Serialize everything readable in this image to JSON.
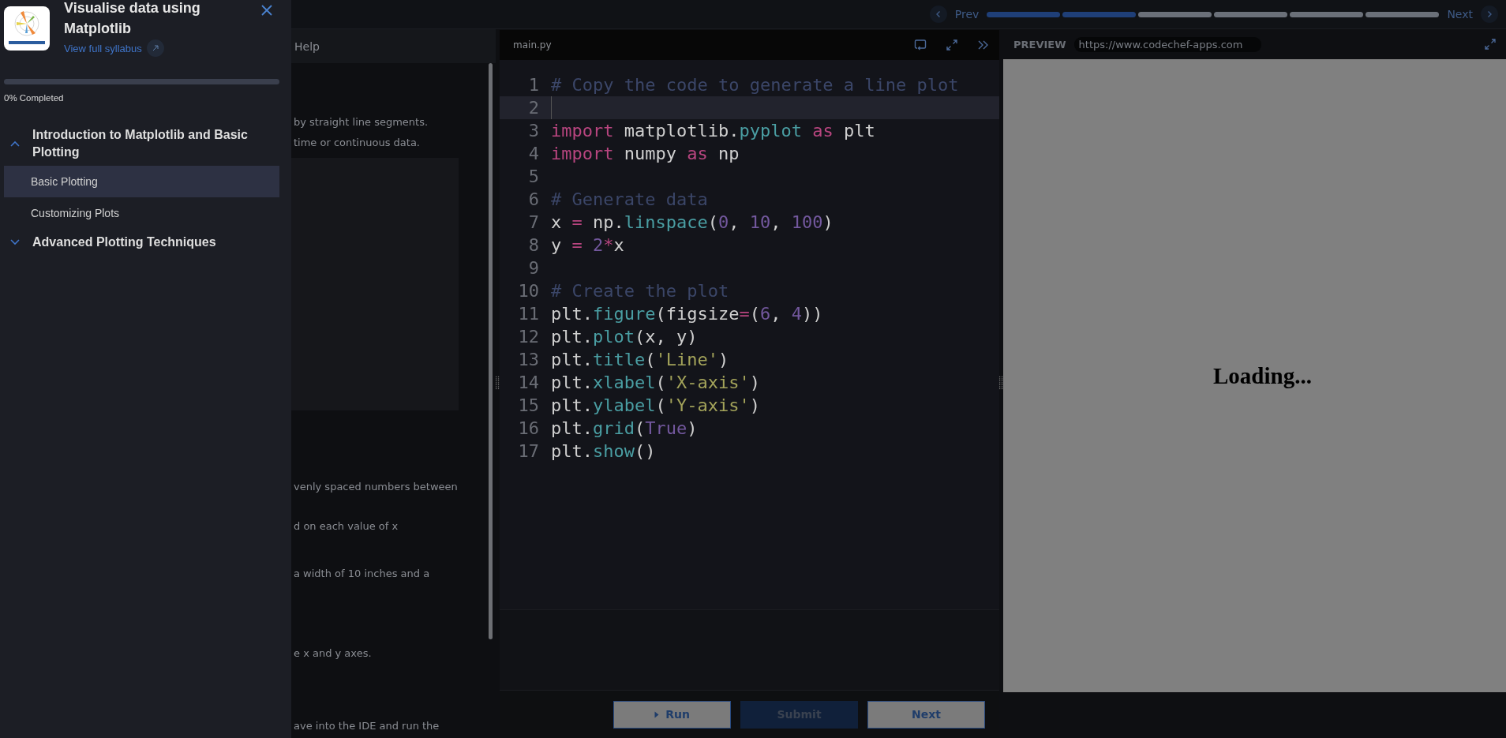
{
  "sidebar": {
    "title": "Visualise data using Matplotlib",
    "syllabus_link": "View full syllabus",
    "progress": {
      "level": 0,
      "label": "0% Completed"
    },
    "sections": [
      {
        "title": "Introduction to Matplotlib and Basic Plotting",
        "expanded": true,
        "children": [
          {
            "label": "Basic Plotting",
            "selected": true
          },
          {
            "label": "Customizing Plots",
            "selected": false
          }
        ]
      },
      {
        "title": "Advanced Plotting Techniques",
        "expanded": false
      }
    ]
  },
  "top_nav": {
    "prev": "Prev",
    "next": "Next",
    "steps": [
      {
        "completed": true
      },
      {
        "completed": true
      },
      {
        "completed": false
      },
      {
        "completed": false
      },
      {
        "completed": false
      },
      {
        "completed": false
      }
    ]
  },
  "lesson": {
    "tab": "Help",
    "paragraphs": [
      {
        "kind": "text",
        "text": "by straight line segments."
      },
      {
        "kind": "text",
        "text": "time or continuous data."
      },
      {
        "kind": "image"
      },
      {
        "kind": "text",
        "text": "venly spaced numbers between"
      },
      {
        "kind": "text",
        "text": "d on each value of x"
      },
      {
        "kind": "text",
        "text": "a width of 10 inches and a"
      },
      {
        "kind": "text",
        "text": "e x and y axes."
      },
      {
        "kind": "text",
        "text": "ave into the IDE and run the"
      }
    ]
  },
  "editor": {
    "filename": "main.py",
    "lines": [
      {
        "n": "1",
        "current": false,
        "tokens": [
          {
            "comment": "# Copy the code to generate a line plot"
          }
        ]
      },
      {
        "n": "2",
        "current": true
      },
      {
        "n": "3",
        "current": false,
        "tokens": [
          {
            "keyword": "import"
          },
          {
            "plain": " matplotlib."
          },
          {
            "func": "pyplot"
          },
          {
            "keyword": " as"
          },
          {
            "plain": " plt"
          }
        ]
      },
      {
        "n": "4",
        "current": false,
        "tokens": [
          {
            "keyword": "import"
          },
          {
            "plain": " numpy "
          },
          {
            "keyword": "as"
          },
          {
            "plain": " np"
          }
        ]
      },
      {
        "n": "5",
        "current": false
      },
      {
        "n": "6",
        "current": false,
        "tokens": [
          {
            "comment": "# Generate data"
          }
        ]
      },
      {
        "n": "7",
        "current": false,
        "tokens": [
          {
            "plain": "x "
          },
          {
            "operator": "="
          },
          {
            "plain": " np."
          },
          {
            "func": "linspace"
          },
          {
            "plain": "("
          },
          {
            "number": "0"
          },
          {
            "plain": ", "
          },
          {
            "number": "10"
          },
          {
            "plain": ", "
          },
          {
            "number": "100"
          },
          {
            "plain": ")"
          }
        ]
      },
      {
        "n": "8",
        "current": false,
        "tokens": [
          {
            "plain": "y "
          },
          {
            "operator": "= "
          },
          {
            "number": "2"
          },
          {
            "operator": "*"
          },
          {
            "plain": "x"
          }
        ]
      },
      {
        "n": "9",
        "current": false
      },
      {
        "n": "10",
        "current": false,
        "tokens": [
          {
            "comment": "# Create the plot"
          }
        ]
      },
      {
        "n": "11",
        "current": false,
        "tokens": [
          {
            "plain": "plt."
          },
          {
            "func": "figure"
          },
          {
            "plain": "(figsize"
          },
          {
            "operator": "="
          },
          {
            "plain": "("
          },
          {
            "number": "6"
          },
          {
            "plain": ", "
          },
          {
            "number": "4"
          },
          {
            "plain": "))"
          }
        ]
      },
      {
        "n": "12",
        "current": false,
        "tokens": [
          {
            "plain": "plt."
          },
          {
            "func": "plot"
          },
          {
            "plain": "(x, y)"
          }
        ]
      },
      {
        "n": "13",
        "current": false,
        "tokens": [
          {
            "plain": "plt."
          },
          {
            "func": "title"
          },
          {
            "plain": "("
          },
          {
            "string": "'Line'"
          },
          {
            "plain": ")"
          }
        ]
      },
      {
        "n": "14",
        "current": false,
        "tokens": [
          {
            "plain": "plt."
          },
          {
            "func": "xlabel"
          },
          {
            "plain": "("
          },
          {
            "string": "'X-axis'"
          },
          {
            "plain": ")"
          }
        ]
      },
      {
        "n": "15",
        "current": false,
        "tokens": [
          {
            "plain": "plt."
          },
          {
            "func": "ylabel"
          },
          {
            "plain": "("
          },
          {
            "string": "'Y-axis'"
          },
          {
            "plain": ")"
          }
        ]
      },
      {
        "n": "16",
        "current": false,
        "tokens": [
          {
            "plain": "plt."
          },
          {
            "func": "grid"
          },
          {
            "plain": "("
          },
          {
            "number": "True"
          },
          {
            "plain": ")"
          }
        ]
      },
      {
        "n": "17",
        "current": false,
        "tokens": [
          {
            "plain": "plt."
          },
          {
            "func": "show"
          },
          {
            "plain": "()"
          }
        ]
      }
    ],
    "buttons": [
      {
        "label": "Run",
        "kind": "run",
        "disabled": false
      },
      {
        "label": "Submit",
        "kind": "submit",
        "disabled": true
      },
      {
        "label": "Next",
        "kind": "next",
        "disabled": false
      }
    ]
  },
  "preview": {
    "label": "PREVIEW",
    "url": "https://www.codechef-apps.com",
    "message": "Loading..."
  }
}
